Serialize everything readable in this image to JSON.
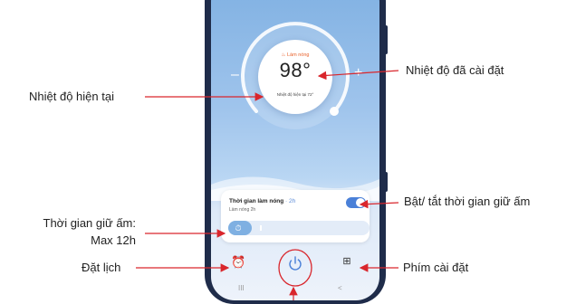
{
  "annotations": {
    "set_temperature": "Nhiệt độ đã cài đặt",
    "current_temperature": "Nhiệt độ hiện tại",
    "toggle_keep_warm": "Bật/ tắt thời gian giữ ấm",
    "keep_warm_time_line1": "Thời gian giữ ấm:",
    "keep_warm_time_line2": "Max 12h",
    "schedule": "Đặt lịch",
    "settings_key": "Phím cài đặt"
  },
  "thermostat": {
    "mode_label": "♨ Làm nóng",
    "set_temp": "98°",
    "current_temp_label": "Nhiệt độ hiện tại  72°",
    "minus": "–",
    "plus": "+",
    "dial_level": 0.75
  },
  "card": {
    "title": "Thời gian làm nóng",
    "duration": " · 2h",
    "subtitle": "Làm nóng 2h",
    "toggle_on": true,
    "slider_fraction": 0.167
  },
  "bottom_bar": {
    "schedule_icon": "alarm-clock-icon",
    "power_icon": "power-icon",
    "settings_icon": "grid-icon"
  },
  "nav": {
    "recents": "III",
    "back": "<"
  },
  "colors": {
    "accent": "#4a80d8",
    "callout": "#d9262c",
    "heat": "#e8622b"
  }
}
